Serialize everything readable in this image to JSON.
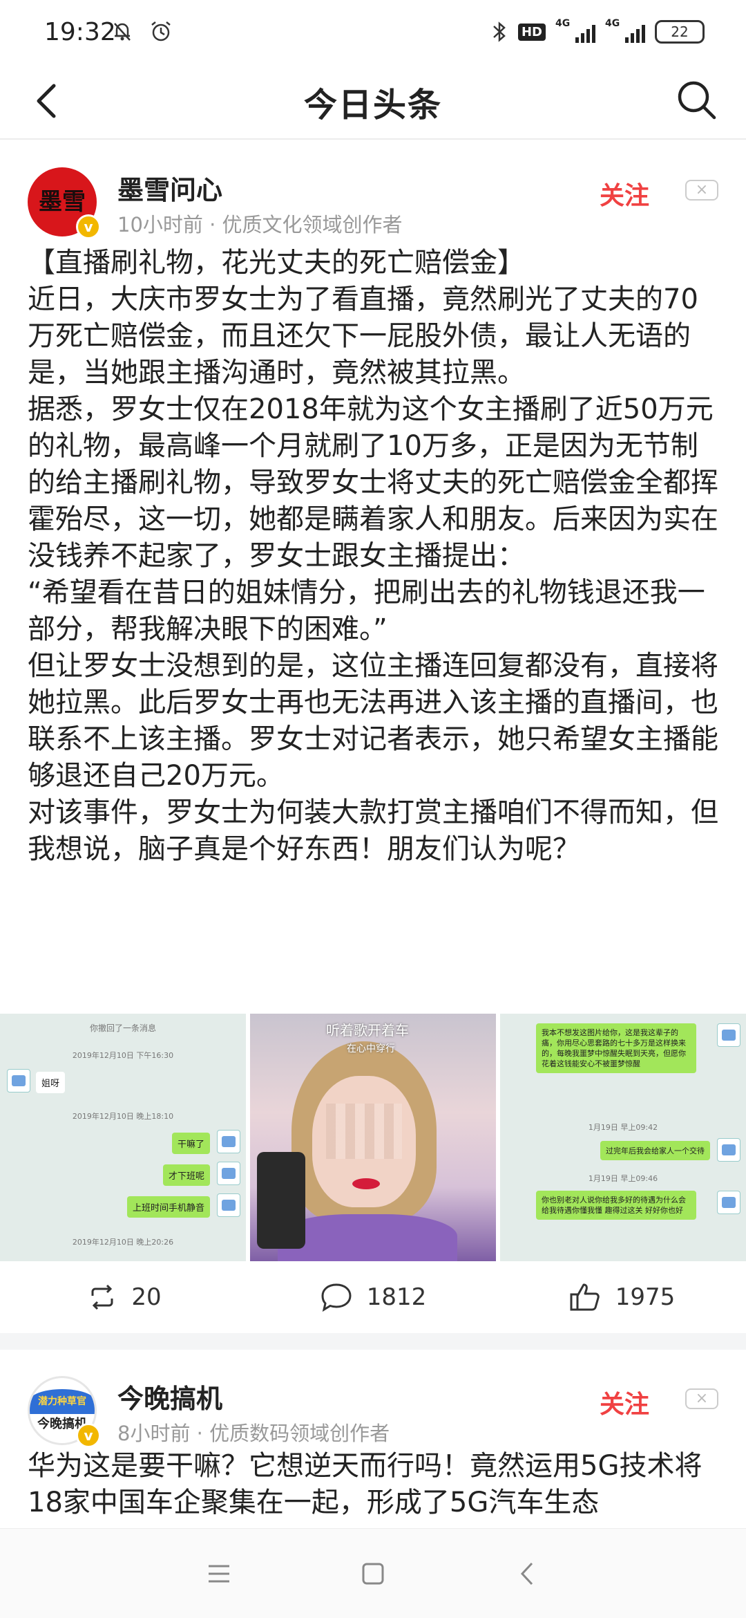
{
  "status_bar": {
    "time": "19:32",
    "hd": "HD",
    "net1": "4G",
    "net2": "4G",
    "battery": "22"
  },
  "header": {
    "title": "今日头条"
  },
  "post1": {
    "author": "墨雪问心",
    "avatar_text": "墨雪",
    "meta": "10小时前 · 优质文化领域创作者",
    "follow": "关注",
    "dismiss": "×",
    "paragraphs": [
      "【直播刷礼物，花光丈夫的死亡赔偿金】",
      "近日，大庆市罗女士为了看直播，竟然刷光了丈夫的70万死亡赔偿金，而且还欠下一屁股外债，最让人无语的是，当她跟主播沟通时，竟然被其拉黑。",
      "据悉，罗女士仅在2018年就为这个女主播刷了近50万元的礼物，最高峰一个月就刷了10万多，正是因为无节制的给主播刷礼物，导致罗女士将丈夫的死亡赔偿金全都挥霍殆尽，这一切，她都是瞒着家人和朋友。后来因为实在没钱养不起家了，罗女士跟女主播提出：",
      "“希望看在昔日的姐妹情分，把刷出去的礼物钱退还我一部分，帮我解决眼下的困难。”",
      "但让罗女士没想到的是，这位主播连回复都没有，直接将她拉黑。此后罗女士再也无法再进入该主播的直播间，也联系不上该主播。罗女士对记者表示，她只希望女主播能够退还自己20万元。",
      "对该事件，罗女士为何装大款打赏主播咱们不得而知，但我想说，脑子真是个好东西！朋友们认为呢？"
    ],
    "image1": {
      "header": "你撤回了一条消息",
      "time1": "2019年12月10日 下午16:30",
      "msg1": "姐呀",
      "time2": "2019年12月10日 晚上18:10",
      "msg2": "干嘛了",
      "msg3": "才下班呢",
      "msg4": "上班时间手机静音",
      "time3": "2019年12月10日 晚上20:26"
    },
    "image2": {
      "caption": "听着歌开着车",
      "caption2": "在心中穿行"
    },
    "image3": {
      "msg1": "我本不想发这图片给你，这是我这辈子的痛，你用尽心思套路的七十多万是这样换来的，每晚我噩梦中惊醒失眠到天亮，但愿你花着这钱能安心不被噩梦惊醒",
      "time1": "1月19日 早上09:42",
      "msg2": "过完年后我会给家人一个交待",
      "time2": "1月19日 早上09:46",
      "msg3": "你也别老对人说你给我多好的待遇为什么会给我待遇你懂我懂 趣得过这关 好好你也好"
    },
    "actions": {
      "repost": "20",
      "comment": "1812",
      "like": "1975"
    }
  },
  "post2": {
    "author": "今晚搞机",
    "avatar_top": "潜力种草官",
    "avatar_text": "今晚搞机",
    "meta": "8小时前 · 优质数码领域创作者",
    "follow": "关注",
    "dismiss": "×",
    "body": "华为这是要干嘛？它想逆天而行吗！竟然运用5G技术将18家中国车企聚集在一起，形成了5G汽车生态"
  },
  "icons": {
    "back": "back-arrow-icon",
    "search": "search-icon",
    "repost": "repost-icon",
    "comment": "comment-icon",
    "like": "thumbs-up-icon",
    "nav_menu": "menu-icon",
    "nav_home": "home-square-icon",
    "nav_back": "back-triangle-icon"
  },
  "colors": {
    "accent": "#f04142",
    "verified": "#f2b700"
  }
}
